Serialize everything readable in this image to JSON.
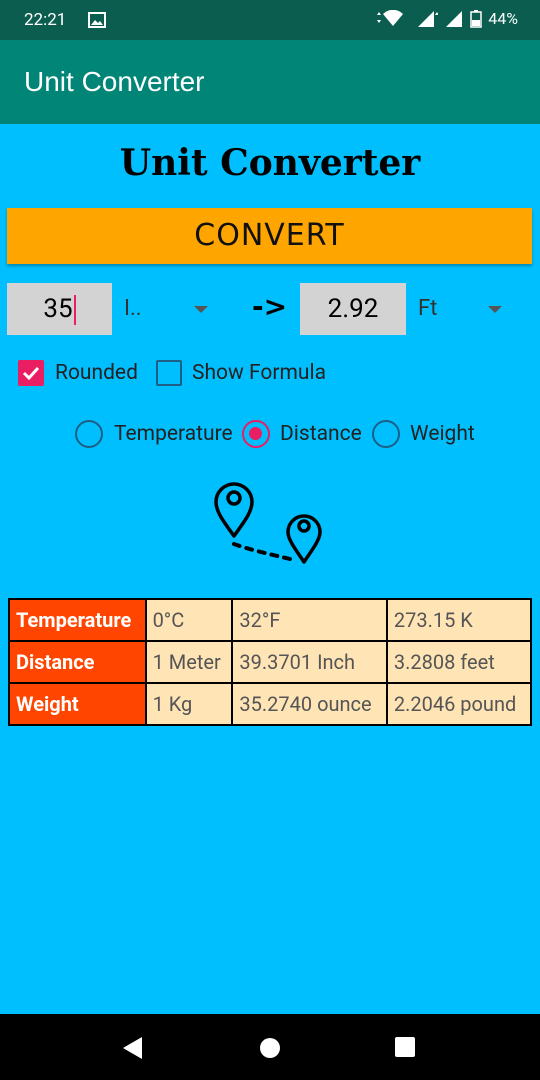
{
  "status": {
    "time": "22:21",
    "battery": "44%"
  },
  "app": {
    "title": "Unit Converter"
  },
  "main": {
    "heading": "Unit Converter",
    "convert_label": "CONVERT",
    "input_value": "35",
    "input_unit": "I..",
    "arrow": "->",
    "output_value": "2.92",
    "output_unit": "Ft",
    "rounded_label": "Rounded",
    "show_formula_label": "Show Formula",
    "radio": {
      "temperature": "Temperature",
      "distance": "Distance",
      "weight": "Weight"
    }
  },
  "table": {
    "rows": [
      [
        "Temperature",
        "0°C",
        "32°F",
        "273.15 K"
      ],
      [
        "Distance",
        "1 Meter",
        "39.3701 Inch",
        "3.2808 feet"
      ],
      [
        "Weight",
        "1 Kg",
        "35.2740 ounce",
        "2.2046 pound"
      ]
    ]
  },
  "icons": {
    "route": "route-map-pin-icon"
  }
}
